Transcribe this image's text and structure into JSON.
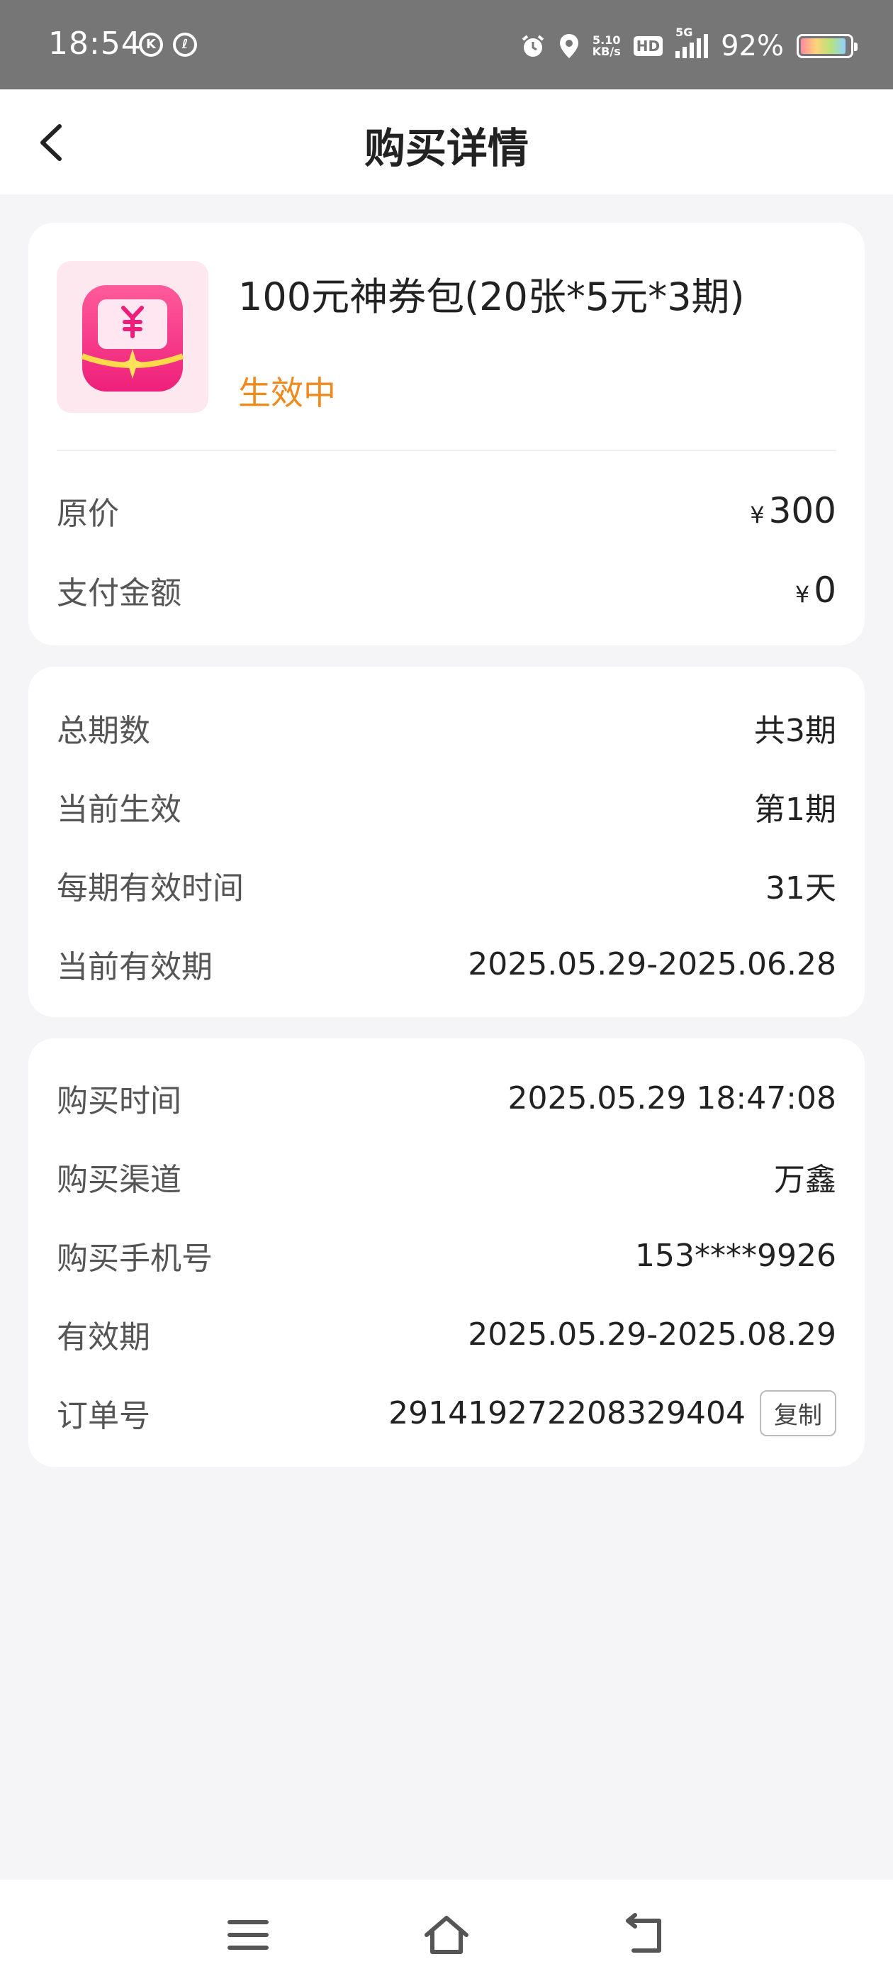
{
  "status_bar": {
    "time": "18:54",
    "left_icons": [
      "K",
      "ℓ"
    ],
    "net_speed_top": "5.10",
    "net_speed_bottom": "KB/s",
    "hd": "HD",
    "network": "5G",
    "battery_percent": "92%",
    "battery_level": 0.92
  },
  "header": {
    "title": "购买详情"
  },
  "product": {
    "name": "100元神券包(20张*5元*3期)",
    "status": "生效中",
    "status_color": "#f08a1c",
    "icon": "coupon-wallet-icon"
  },
  "pricing": {
    "original_label": "原价",
    "original_currency": "¥",
    "original_value": "300",
    "paid_label": "支付金额",
    "paid_currency": "¥",
    "paid_value": "0"
  },
  "period": {
    "total_label": "总期数",
    "total_value": "共3期",
    "current_label": "当前生效",
    "current_value": "第1期",
    "per_period_label": "每期有效时间",
    "per_period_value": "31天",
    "current_validity_label": "当前有效期",
    "current_validity_value": "2025.05.29-2025.06.28"
  },
  "order": {
    "time_label": "购买时间",
    "time_value": "2025.05.29 18:47:08",
    "channel_label": "购买渠道",
    "channel_value": "万鑫",
    "phone_label": "购买手机号",
    "phone_value": "153****9926",
    "validity_label": "有效期",
    "validity_value": "2025.05.29-2025.08.29",
    "order_no_label": "订单号",
    "order_no_value": "291419272208329404",
    "copy_label": "复制"
  },
  "nav": {
    "icons": [
      "menu-icon",
      "home-icon",
      "back-icon"
    ]
  }
}
